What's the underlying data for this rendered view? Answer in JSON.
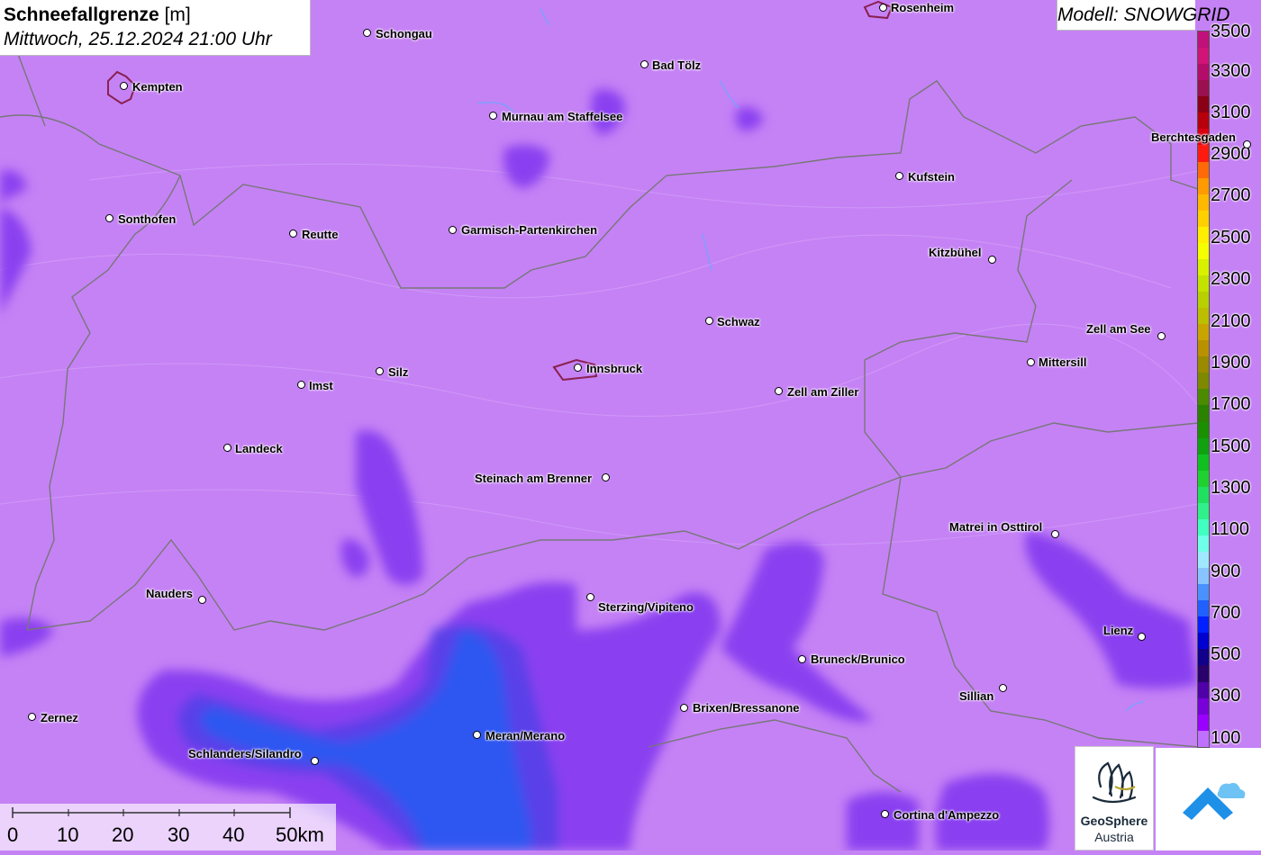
{
  "header": {
    "title_bold": "Schneefallgrenze",
    "title_unit": "[m]",
    "datetime": "Mittwoch, 25.12.2024 21:00 Uhr"
  },
  "model": {
    "label": "Modell: SNOWGRID"
  },
  "legend": {
    "labels": [
      "3500",
      "3300",
      "3100",
      "2900",
      "2700",
      "2500",
      "2300",
      "2100",
      "1900",
      "1700",
      "1500",
      "1300",
      "1100",
      "900",
      "700",
      "500",
      "300",
      "100"
    ],
    "colors": [
      "#c0107a",
      "#d01478",
      "#b40c6a",
      "#9a1050",
      "#8a0016",
      "#b8000c",
      "#d80010",
      "#ff1a10",
      "#ff6a08",
      "#ff9a00",
      "#ffb800",
      "#ffd000",
      "#ffee00",
      "#f6ff00",
      "#d9f000",
      "#c4e200",
      "#b8d000",
      "#bcbe00",
      "#c8a400",
      "#b89000",
      "#9a8a00",
      "#7e8800",
      "#4c8a00",
      "#2a8200",
      "#1a9000",
      "#10a010",
      "#10c020",
      "#20d030",
      "#20e060",
      "#30f08a",
      "#40ffc0",
      "#70ffe8",
      "#a0e8ff",
      "#88c4ff",
      "#4a90ff",
      "#2060ff",
      "#0020ff",
      "#0000d0",
      "#10008a",
      "#2a006a",
      "#5000a8",
      "#7800d8",
      "#9a00ff",
      "#c070ff"
    ],
    "unit_colors": {
      "high": "#c0107a",
      "low": "#c070ff"
    }
  },
  "cities": [
    {
      "name": "Rosenheim"
    },
    {
      "name": "Schongau"
    },
    {
      "name": "Kempten"
    },
    {
      "name": "Bad Tölz"
    },
    {
      "name": "Murnau am Staffelsee"
    },
    {
      "name": "Berchtesgaden"
    },
    {
      "name": "Kufstein"
    },
    {
      "name": "Sonthofen"
    },
    {
      "name": "Reutte"
    },
    {
      "name": "Garmisch-Partenkirchen"
    },
    {
      "name": "Kitzbühel"
    },
    {
      "name": "Schwaz"
    },
    {
      "name": "Zell am See"
    },
    {
      "name": "Mittersill"
    },
    {
      "name": "Imst"
    },
    {
      "name": "Silz"
    },
    {
      "name": "Innsbruck"
    },
    {
      "name": "Zell am Ziller"
    },
    {
      "name": "Landeck"
    },
    {
      "name": "Steinach am Brenner"
    },
    {
      "name": "Matrei in Osttirol"
    },
    {
      "name": "Nauders"
    },
    {
      "name": "Sterzing/Vipiteno"
    },
    {
      "name": "Lienz"
    },
    {
      "name": "Bruneck/Brunico"
    },
    {
      "name": "Sillian"
    },
    {
      "name": "Zernez"
    },
    {
      "name": "Brixen/Bressanone"
    },
    {
      "name": "Meran/Merano"
    },
    {
      "name": "Schlanders/Silandro"
    },
    {
      "name": "Cortina d'Ampezzo"
    }
  ],
  "scale": {
    "labels": [
      "0",
      "10",
      "20",
      "30",
      "40",
      "50km"
    ]
  },
  "logos": {
    "geosphere_name": "GeoSphere",
    "geosphere_sub": "Austria"
  },
  "colors": {
    "map_base": "#c582f5",
    "low_zone": "#8a3ff0",
    "lower_zone": "#5a3fe8",
    "lowest_zone": "#2048f0"
  }
}
